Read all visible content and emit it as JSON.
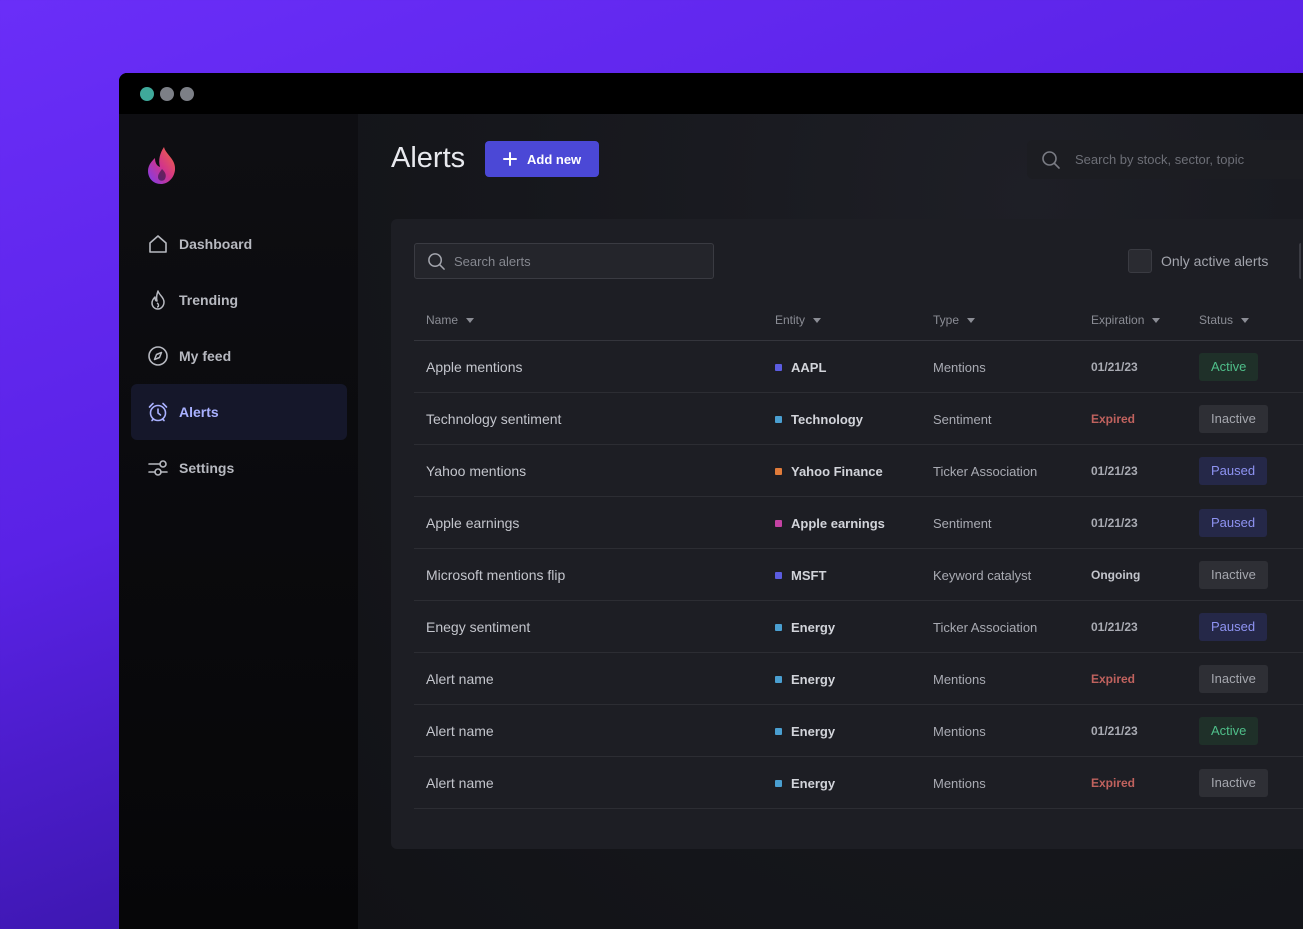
{
  "window": {
    "title": ""
  },
  "sidebar": {
    "items": [
      {
        "label": "Dashboard",
        "icon": "home-icon",
        "active": false
      },
      {
        "label": "Trending",
        "icon": "flame-icon",
        "active": false
      },
      {
        "label": "My feed",
        "icon": "compass-icon",
        "active": false
      },
      {
        "label": "Alerts",
        "icon": "alarm-clock-icon",
        "active": true
      },
      {
        "label": "Settings",
        "icon": "sliders-icon",
        "active": false
      }
    ]
  },
  "header": {
    "title": "Alerts",
    "add_label": "Add new",
    "search_placeholder": "Search by stock, sector, topic"
  },
  "panel": {
    "search_placeholder": "Search alerts",
    "only_active_label": "Only active alerts",
    "columns": [
      "Name",
      "Entity",
      "Type",
      "Expiration",
      "Status"
    ],
    "rows": [
      {
        "name": "Apple mentions",
        "entity": "AAPL",
        "entity_color": "#5b5ce0",
        "type": "Mentions",
        "expiration": "01/21/23",
        "exp_kind": "date",
        "status": "Active",
        "status_kind": "active"
      },
      {
        "name": "Technology sentiment",
        "entity": "Technology",
        "entity_color": "#4a9fd1",
        "type": "Sentiment",
        "expiration": "Expired",
        "exp_kind": "expired",
        "status": "Inactive",
        "status_kind": "inactive"
      },
      {
        "name": "Yahoo mentions",
        "entity": "Yahoo Finance",
        "entity_color": "#e07b3a",
        "type": "Ticker Association",
        "expiration": "01/21/23",
        "exp_kind": "date",
        "status": "Paused",
        "status_kind": "paused"
      },
      {
        "name": "Apple earnings",
        "entity": "Apple earnings",
        "entity_color": "#c442a3",
        "type": "Sentiment",
        "expiration": "01/21/23",
        "exp_kind": "date",
        "status": "Paused",
        "status_kind": "paused"
      },
      {
        "name": "Microsoft mentions flip",
        "entity": "MSFT",
        "entity_color": "#5b5ce0",
        "type": "Keyword catalyst",
        "expiration": "Ongoing",
        "exp_kind": "ongoing",
        "status": "Inactive",
        "status_kind": "inactive"
      },
      {
        "name": "Enegy sentiment",
        "entity": "Energy",
        "entity_color": "#4a9fd1",
        "type": "Ticker Association",
        "expiration": "01/21/23",
        "exp_kind": "date",
        "status": "Paused",
        "status_kind": "paused"
      },
      {
        "name": "Alert name",
        "entity": "Energy",
        "entity_color": "#4a9fd1",
        "type": "Mentions",
        "expiration": "Expired",
        "exp_kind": "expired",
        "status": "Inactive",
        "status_kind": "inactive"
      },
      {
        "name": "Alert name",
        "entity": "Energy",
        "entity_color": "#4a9fd1",
        "type": "Mentions",
        "expiration": "01/21/23",
        "exp_kind": "date",
        "status": "Active",
        "status_kind": "active"
      },
      {
        "name": "Alert name",
        "entity": "Energy",
        "entity_color": "#4a9fd1",
        "type": "Mentions",
        "expiration": "Expired",
        "exp_kind": "expired",
        "status": "Inactive",
        "status_kind": "inactive"
      }
    ]
  },
  "colors": {
    "accent": "#4b48d6",
    "active": "#4fbf8a",
    "expired": "#c0625e",
    "paused": "#8e93f2"
  }
}
